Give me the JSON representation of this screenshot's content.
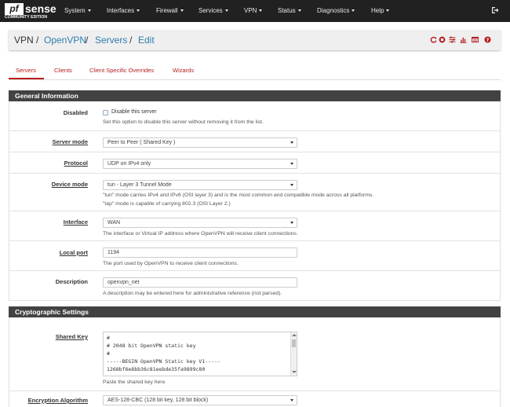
{
  "brand": {
    "logo_pf": "pf",
    "logo_sense": "sense",
    "edition": "COMMUNITY EDITION"
  },
  "nav": [
    "System",
    "Interfaces",
    "Firewall",
    "Services",
    "VPN",
    "Status",
    "Diagnostics",
    "Help"
  ],
  "breadcrumb": {
    "root": "VPN",
    "openvpn": "OpenVPN",
    "servers": "Servers",
    "edit": "Edit",
    "sep": "/"
  },
  "tabs": [
    "Servers",
    "Clients",
    "Client Specific Overrides",
    "Wizards"
  ],
  "general": {
    "title": "General Information",
    "disabled": {
      "label": "Disabled",
      "checkbox_label": "Disable this server",
      "help": "Set this option to disable this server without removing it from the list.",
      "checked": false
    },
    "server_mode": {
      "label": "Server mode",
      "value": "Peer to Peer ( Shared Key )"
    },
    "protocol": {
      "label": "Protocol",
      "value": "UDP on IPv4 only"
    },
    "device_mode": {
      "label": "Device mode",
      "value": "tun - Layer 3 Tunnel Mode",
      "help1": "\"tun\" mode carries IPv4 and IPv6 (OSI layer 3) and is the most common and compatible mode across all platforms.",
      "help2": "\"tap\" mode is capable of carrying 802.3 (OSI Layer 2.)"
    },
    "interface": {
      "label": "Interface",
      "value": "WAN",
      "help": "The interface or Virtual IP address where OpenVPN will receive client connections."
    },
    "local_port": {
      "label": "Local port",
      "value": "1194",
      "help": "The port used by OpenVPN to receive client connections."
    },
    "description": {
      "label": "Description",
      "value": "openvpn_net",
      "help": "A description may be entered here for administrative reference (not parsed)."
    }
  },
  "crypto": {
    "title": "Cryptographic Settings",
    "shared_key": {
      "label": "Shared Key",
      "lines": [
        "#",
        "# 2048 bit OpenVPN static key",
        "#",
        "-----BEGIN OpenVPN Static key V1-----",
        "1268bf6e8bb36c81eebde35fa9899c80"
      ],
      "help": "Paste the shared key here"
    },
    "encryption": {
      "label": "Encryption Algorithm",
      "value": "AES-128-CBC (128 bit key, 128 bit block)"
    }
  },
  "colors": {
    "navbar": "#212121",
    "accent": "#b71c1c",
    "link": "#2f7dad",
    "panel_head": "#424242"
  }
}
